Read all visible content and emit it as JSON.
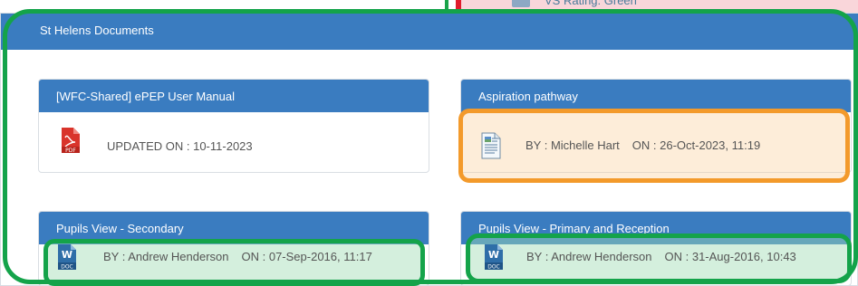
{
  "top_fragment": {
    "text": "VS Rating: Green"
  },
  "panel": {
    "title": "St Helens Documents"
  },
  "documents": [
    {
      "title": "[WFC-Shared] ePEP User Manual",
      "icon": "pdf-icon",
      "icon_label": "PDF",
      "line": "UPDATED ON : 10-11-2023"
    },
    {
      "title": "Aspiration pathway",
      "icon": "document-icon",
      "by": "BY : Michelle Hart",
      "on": "ON : 26-Oct-2023, 11:19"
    },
    {
      "title": "Pupils View - Secondary",
      "icon": "word-doc-icon",
      "icon_label": "DOC",
      "by": "BY : Andrew Henderson",
      "on": "ON : 07-Sep-2016, 11:17"
    },
    {
      "title": "Pupils View - Primary and Reception",
      "icon": "word-doc-icon",
      "icon_label": "DOC",
      "by": "BY : Andrew Henderson",
      "on": "ON : 31-Aug-2016, 10:43"
    }
  ],
  "colors": {
    "header_blue": "#3a7cc0",
    "highlight_green": "#14a34a",
    "highlight_orange": "#f39a2b",
    "alert_red": "#e01b2c"
  }
}
